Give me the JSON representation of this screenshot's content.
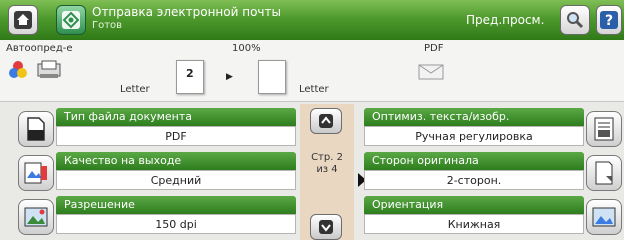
{
  "header": {
    "title": "Отправка электронной почты",
    "status": "Готов",
    "preview_label": "Пред.просм."
  },
  "strip": {
    "auto_label": "Автоопред-е",
    "scale_label": "100%",
    "format_label": "PDF",
    "source_paper": "Letter",
    "output_paper": "Letter",
    "copies_value": "2"
  },
  "settings_left": [
    {
      "label": "Тип файла документа",
      "value": "PDF",
      "icon": "file-type-icon"
    },
    {
      "label": "Качество на выходе",
      "value": "Средний",
      "icon": "quality-icon"
    },
    {
      "label": "Разрешение",
      "value": "150 dpi",
      "icon": "resolution-icon"
    }
  ],
  "settings_right": [
    {
      "label": "Оптимиз. текста/изобр.",
      "value": "Ручная регулировка",
      "icon": "optimize-icon"
    },
    {
      "label": "Сторон оригинала",
      "value": "2-сторон.",
      "icon": "sides-icon"
    },
    {
      "label": "Ориентация",
      "value": "Книжная",
      "icon": "orientation-icon"
    }
  ],
  "pager": {
    "line1": "Стр. 2",
    "line2": "из 4"
  },
  "colors": {
    "header_green": "#4f9a2e",
    "label_green": "#2e7d1e",
    "pager_bg": "#ead7c2"
  }
}
